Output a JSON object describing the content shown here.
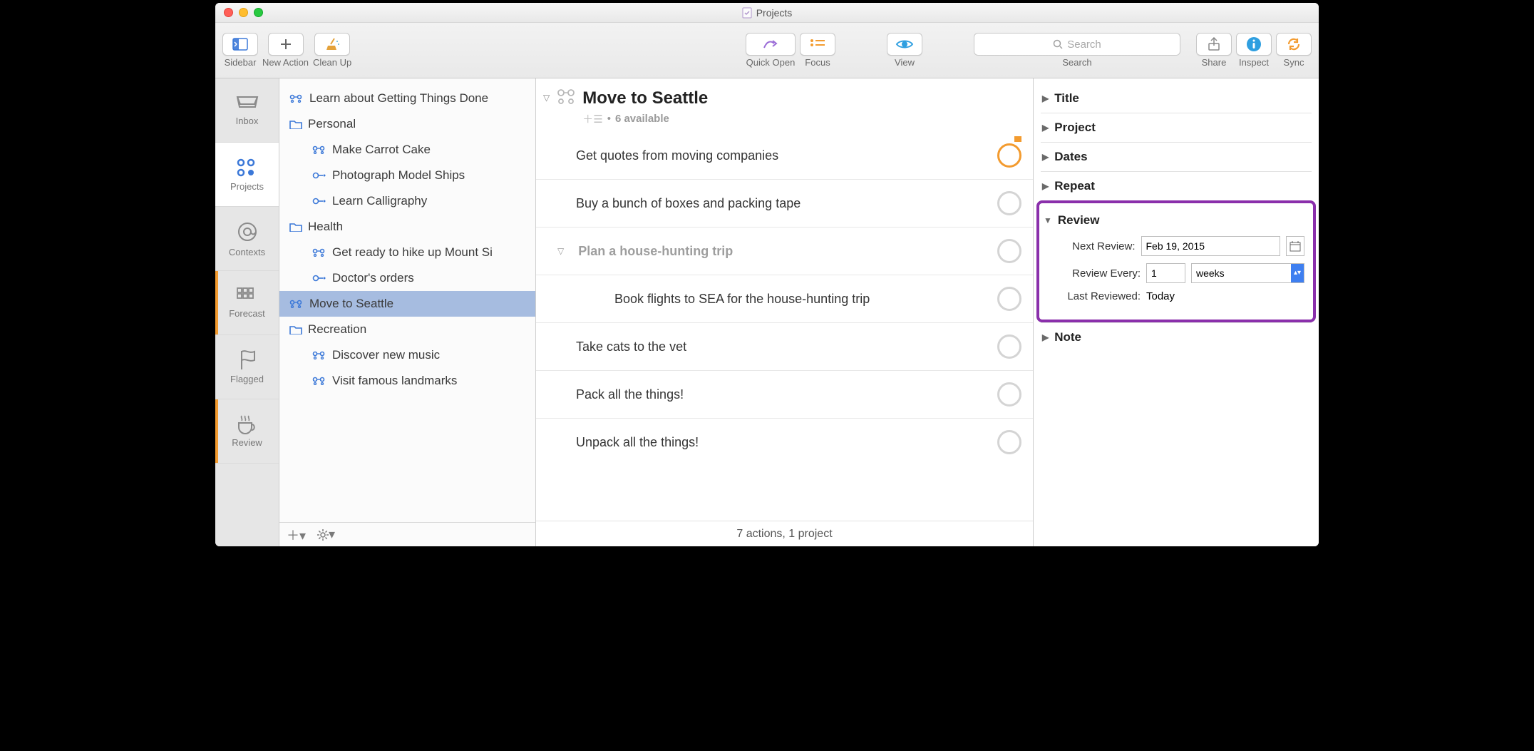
{
  "window": {
    "title": "Projects"
  },
  "toolbar": {
    "sidebar": "Sidebar",
    "new_action": "New Action",
    "clean_up": "Clean Up",
    "quick_open": "Quick Open",
    "focus": "Focus",
    "view": "View",
    "search_label": "Search",
    "search_placeholder": "Search",
    "share": "Share",
    "inspect": "Inspect",
    "sync": "Sync"
  },
  "perspectives": {
    "inbox": "Inbox",
    "projects": "Projects",
    "contexts": "Contexts",
    "forecast": "Forecast",
    "flagged": "Flagged",
    "review": "Review"
  },
  "sidebar": {
    "items": [
      {
        "label": "Learn about Getting Things Done",
        "type": "project",
        "indent": 0
      },
      {
        "label": "Personal",
        "type": "folder",
        "indent": 0
      },
      {
        "label": "Make Carrot Cake",
        "type": "project",
        "indent": 1
      },
      {
        "label": "Photograph Model Ships",
        "type": "single",
        "indent": 1
      },
      {
        "label": "Learn Calligraphy",
        "type": "single",
        "indent": 1
      },
      {
        "label": "Health",
        "type": "folder",
        "indent": 0
      },
      {
        "label": "Get ready to hike up Mount Si",
        "type": "project",
        "indent": 1
      },
      {
        "label": "Doctor's orders",
        "type": "single",
        "indent": 1
      },
      {
        "label": "Move to Seattle",
        "type": "project",
        "indent": 0,
        "selected": true
      },
      {
        "label": "Recreation",
        "type": "folder",
        "indent": 0
      },
      {
        "label": "Discover new music",
        "type": "project",
        "indent": 1
      },
      {
        "label": "Visit famous landmarks",
        "type": "project",
        "indent": 1
      }
    ]
  },
  "main": {
    "title": "Move to Seattle",
    "available_count": "6 available",
    "tasks": [
      {
        "label": "Get quotes from moving companies",
        "flagged": true
      },
      {
        "label": "Buy a bunch of boxes and packing tape"
      },
      {
        "label": "Plan a house-hunting trip",
        "group": true
      },
      {
        "label": "Book flights to SEA for the house-hunting trip",
        "indent": true
      },
      {
        "label": "Take cats to the vet"
      },
      {
        "label": "Pack all the things!"
      },
      {
        "label": "Unpack all the things!"
      }
    ],
    "footer": "7 actions, 1 project"
  },
  "inspector": {
    "sec_title": "Title",
    "sec_project": "Project",
    "sec_dates": "Dates",
    "sec_repeat": "Repeat",
    "sec_review": "Review",
    "sec_note": "Note",
    "review": {
      "next_label": "Next Review:",
      "next_value": "Feb 19, 2015",
      "every_label": "Review Every:",
      "every_value": "1",
      "every_unit": "weeks",
      "last_label": "Last Reviewed:",
      "last_value": "Today"
    }
  }
}
